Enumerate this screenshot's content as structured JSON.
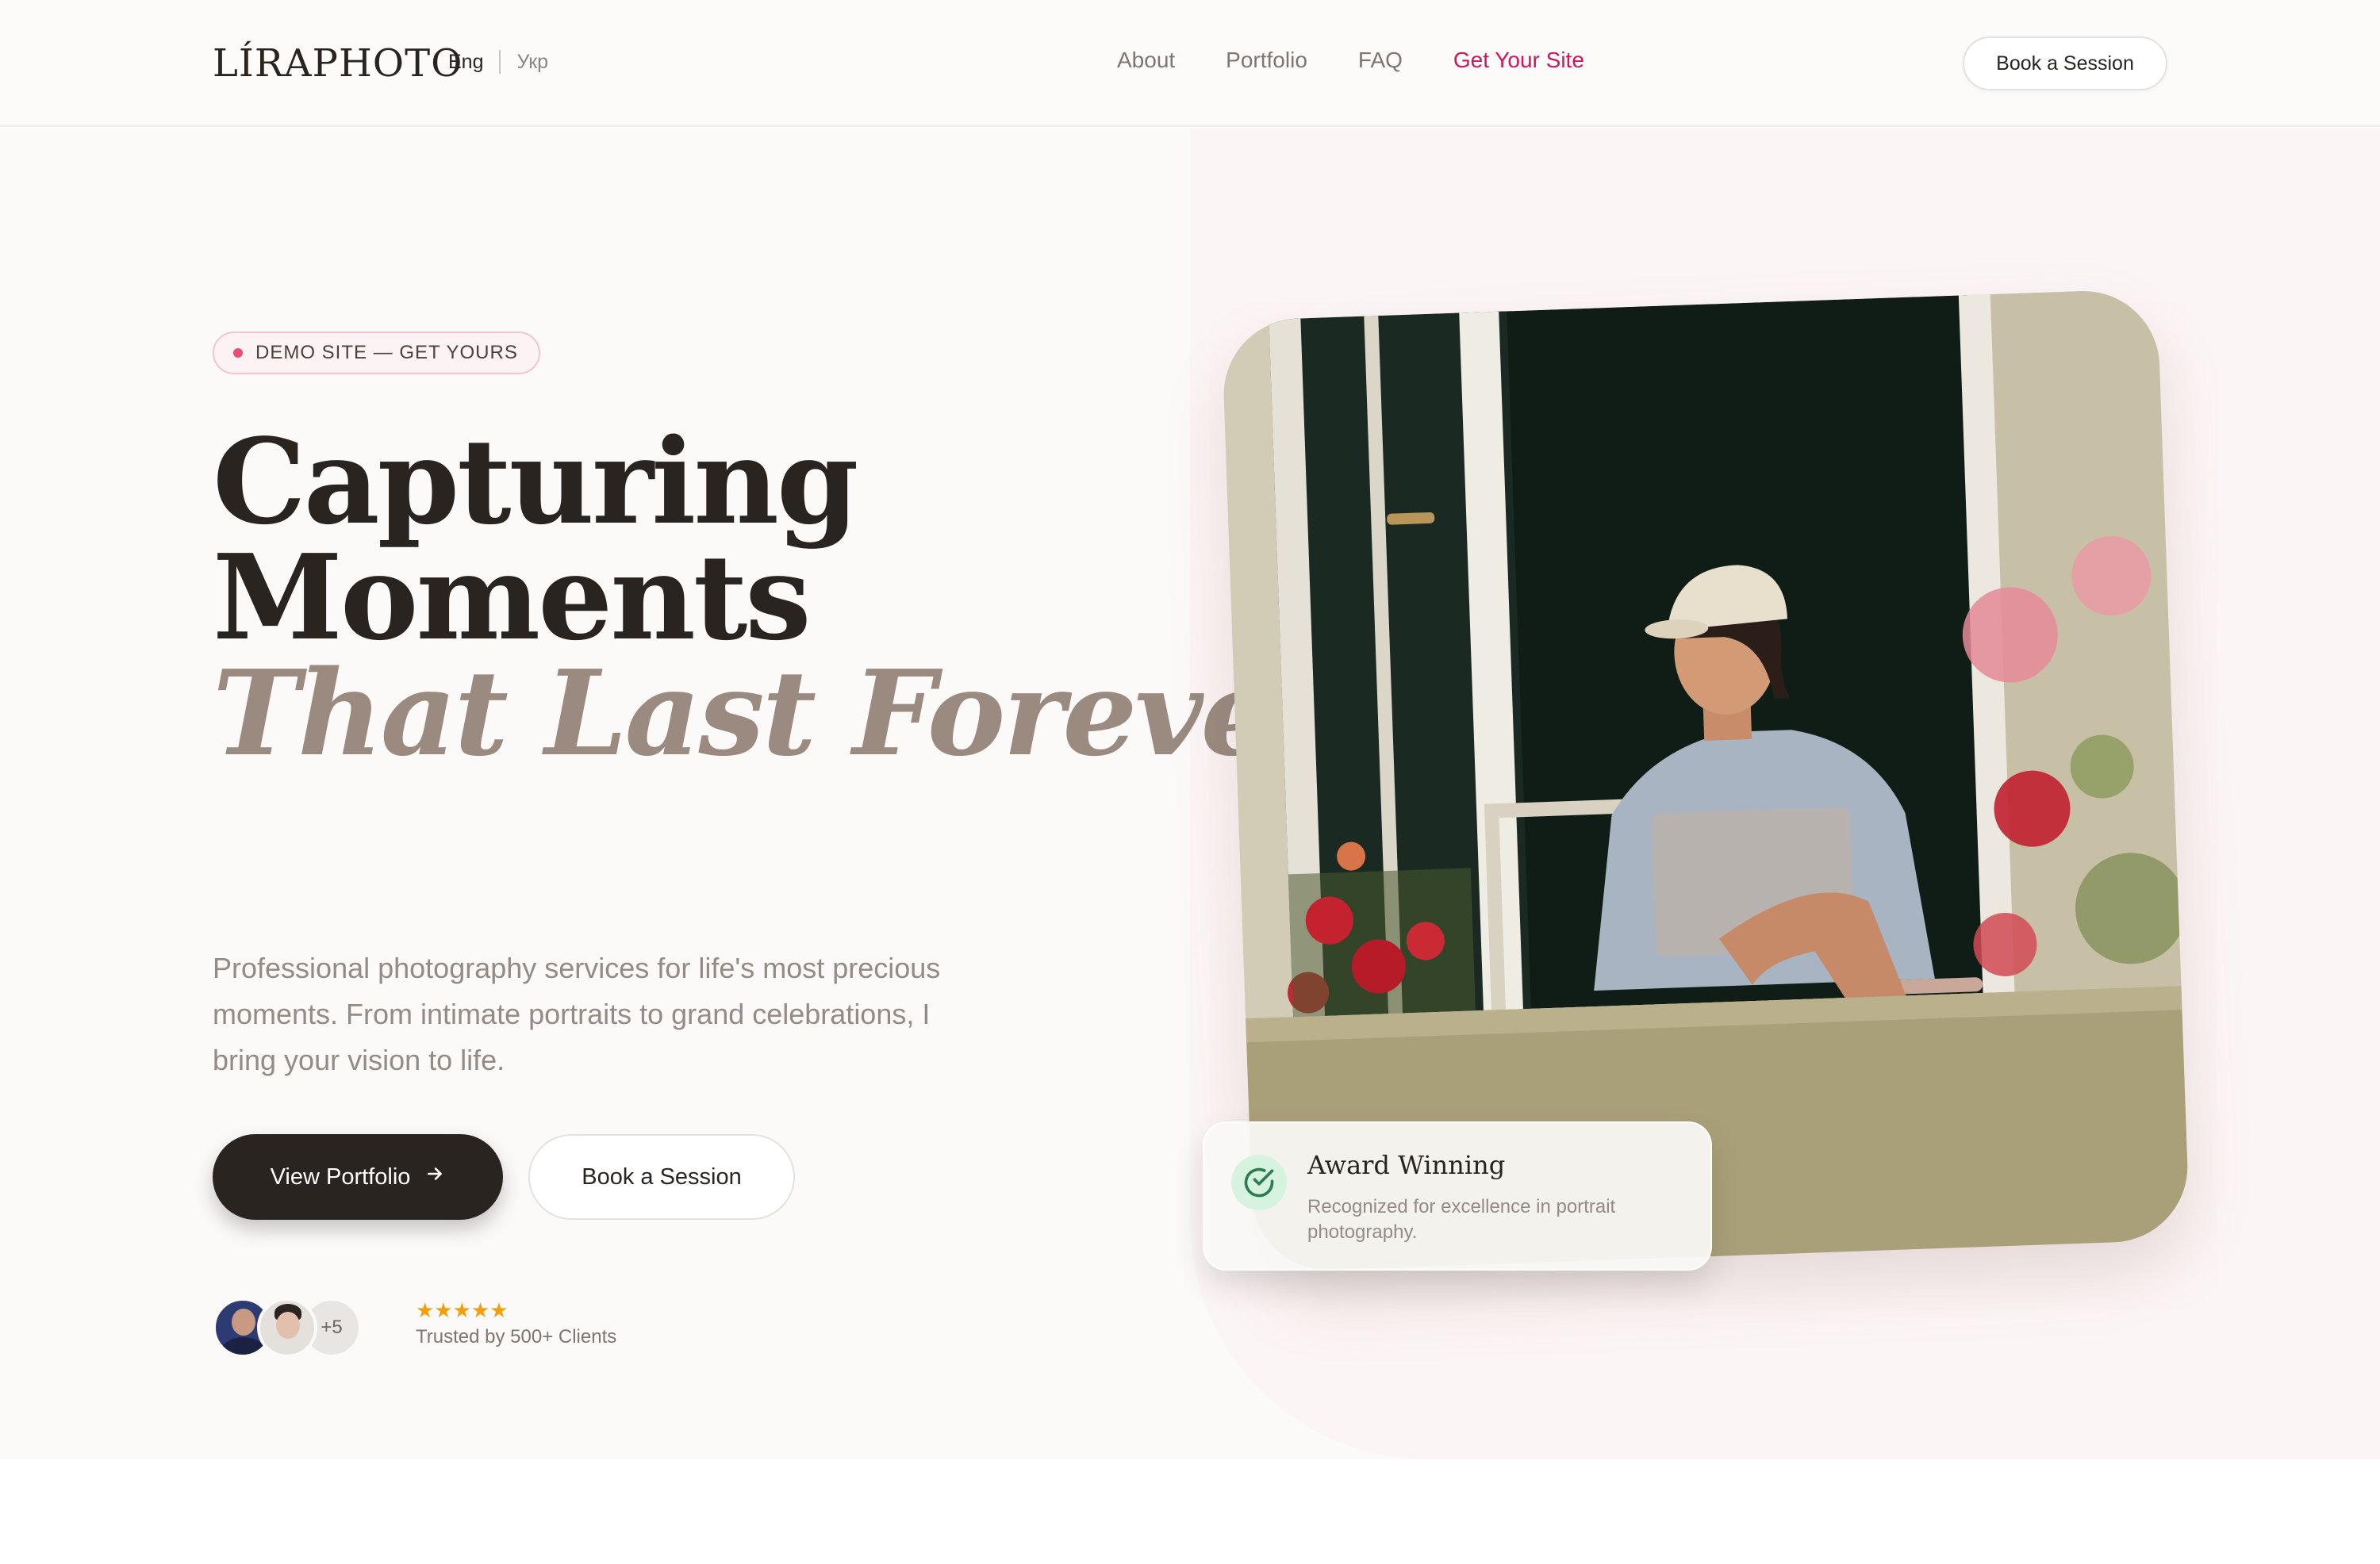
{
  "header": {
    "logo": "LÍRAPHOTO",
    "lang_active": "Eng",
    "lang_other": "Укр",
    "nav": [
      {
        "label": "About"
      },
      {
        "label": "Portfolio"
      },
      {
        "label": "FAQ"
      },
      {
        "label": "Get Your Site"
      }
    ],
    "book_button": "Book a Session"
  },
  "hero": {
    "badge": "DEMO SITE — GET YOURS",
    "headline_line1": "Capturing",
    "headline_line2": "Moments",
    "headline_line3": "That Last Forever.",
    "subtitle": "Professional photography services for life's most precious moments. From intimate portraits to grand celebrations, I bring your vision to life.",
    "primary_button": "View Portfolio",
    "primary_button_icon": "arrow-right-icon",
    "secondary_button": "Book a Session",
    "avatars_more": "+5",
    "stars": "★★★★★",
    "rating_count": 5,
    "trusted": "Trusted by 500+ Clients"
  },
  "award": {
    "title": "Award Winning",
    "description": "Recognized for excellence in portrait photography.",
    "icon": "check-circle-icon"
  },
  "colors": {
    "accent": "#d4145a",
    "dark": "#2a2421",
    "muted": "#958a84",
    "star": "#f59e0b",
    "success": "#2e8b57"
  }
}
